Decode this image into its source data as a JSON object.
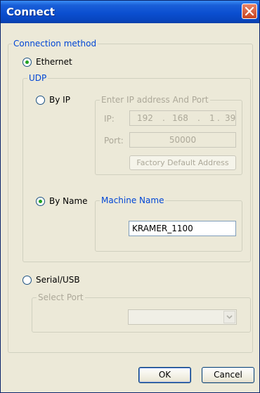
{
  "window": {
    "title": "Connect"
  },
  "connection_method": {
    "legend": "Connection method",
    "ethernet_label": "Ethernet",
    "ethernet_selected": true,
    "serial_label": "Serial/USB",
    "serial_selected": false
  },
  "udp": {
    "legend": "UDP",
    "by_ip_label": "By IP",
    "by_ip_selected": false,
    "by_name_label": "By Name",
    "by_name_selected": true
  },
  "ip_group": {
    "legend": "Enter IP address And Port",
    "ip_label": "IP:",
    "ip_octets": [
      "192",
      "168",
      "1",
      "39"
    ],
    "ip_separators": [
      ".",
      ".",
      "."
    ],
    "port_label": "Port:",
    "port_value": "50000",
    "factory_button": "Factory Default Address"
  },
  "machine_group": {
    "legend": "Machine Name",
    "machine_name": "KRAMER_1100"
  },
  "select_port": {
    "legend": "Select Port",
    "value": ""
  },
  "buttons": {
    "ok": "OK",
    "cancel": "Cancel"
  }
}
